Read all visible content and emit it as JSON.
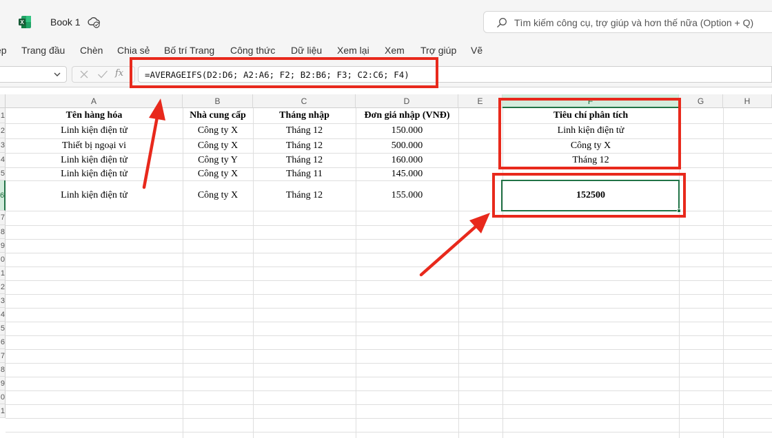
{
  "titlebar": {
    "book_title": "Book 1",
    "search_text": "Tìm kiếm công cụ, trợ giúp và hơn thế nữa (Option + Q)"
  },
  "ribbon": {
    "tabs": [
      "ệp",
      "Trang đầu",
      "Chèn",
      "Chia sẻ",
      "Bố trí Trang",
      "Công thức",
      "Dữ liệu",
      "Xem lại",
      "Xem",
      "Trợ giúp",
      "Vẽ"
    ]
  },
  "formula_bar": {
    "name_box": "",
    "fx_label": "fx",
    "formula": "=AVERAGEIFS(D2:D6; A2:A6; F2; B2:B6; F3; C2:C6; F4)"
  },
  "sheet": {
    "columns": [
      "A",
      "B",
      "C",
      "D",
      "E",
      "F",
      "G",
      "H"
    ],
    "selected_column": "F",
    "selected_row": "6",
    "row_labels": [
      "1",
      "2",
      "3",
      "4",
      "5",
      "6",
      "7",
      "8",
      "9",
      "0",
      "1",
      "2",
      "3",
      "4",
      "5",
      "6",
      "7",
      "8",
      "9",
      "0",
      "1"
    ],
    "headers": {
      "a": "Tên hàng hóa",
      "b": "Nhà cung cấp",
      "c": "Tháng nhập",
      "d": "Đơn giá nhập (VNĐ)",
      "f": "Tiêu chí phân tích"
    },
    "rows": [
      {
        "a": "Linh kiện điện tử",
        "b": "Công ty X",
        "c": "Tháng 12",
        "d": "150.000",
        "f": "Linh kiện điện tử"
      },
      {
        "a": "Thiết bị ngoại vi",
        "b": "Công ty X",
        "c": "Tháng 12",
        "d": "500.000",
        "f": "Công ty X"
      },
      {
        "a": "Linh kiện điện tử",
        "b": "Công ty Y",
        "c": "Tháng 12",
        "d": "160.000",
        "f": "Tháng 12"
      },
      {
        "a": "Linh kiện điện tử",
        "b": "Công ty X",
        "c": "Tháng 11",
        "d": "145.000",
        "f": ""
      },
      {
        "a": "Linh kiện điện tử",
        "b": "Công ty X",
        "c": "Tháng 12",
        "d": "155.000",
        "f": "152500"
      }
    ]
  },
  "colors": {
    "annotation": "#e8291c",
    "selection": "#217346"
  }
}
